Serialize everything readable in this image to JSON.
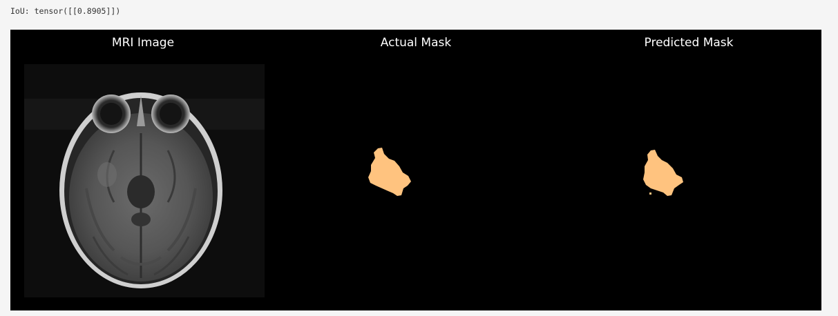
{
  "output": {
    "text": "IoU: tensor([[0.8905]])"
  },
  "figure": {
    "background": "#000000",
    "mask_color": "#ffc37f",
    "panels": [
      {
        "title": "MRI Image"
      },
      {
        "title": "Actual Mask"
      },
      {
        "title": "Predicted Mask"
      }
    ]
  }
}
